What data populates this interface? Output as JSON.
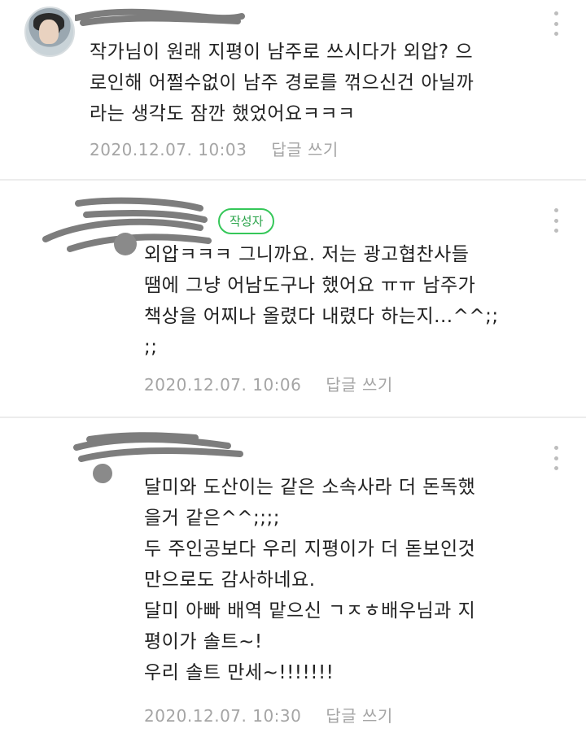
{
  "comments": [
    {
      "is_reply": false,
      "body": "작가님이 원래 지평이 남주로 쓰시다가 외압? 으\n로인해 어쩔수없이 남주 경로를 꺾으신건 아닐까\n라는 생각도 잠깐 했었어요ㅋㅋㅋ",
      "timestamp": "2020.12.07. 10:03",
      "reply_label": "답글 쓰기",
      "more_icon": "more-vertical-icon"
    },
    {
      "is_reply": true,
      "author_badge": "작성자",
      "body": "외압ㅋㅋㅋ 그니까요. 저는 광고협찬사들\n땜에 그냥 어남도구나 했어요 ㅠㅠ 남주가\n책상을 어찌나 올렸다 내렸다 하는지...^^;;\n;;",
      "timestamp": "2020.12.07. 10:06",
      "reply_label": "답글 쓰기",
      "more_icon": "more-vertical-icon"
    },
    {
      "is_reply": true,
      "body": "달미와 도산이는 같은 소속사라 더 돈독했\n을거 같은^^;;;;\n두 주인공보다 우리 지평이가 더 돋보인것\n만으로도 감사하네요.\n달미 아빠 배역 맡으신 ㄱㅈㅎ배우님과 지\n평이가 솔트~!\n우리 솔트 만세~!!!!!!!",
      "timestamp": "2020.12.07. 10:30",
      "reply_label": "답글 쓰기",
      "more_icon": "more-vertical-icon"
    }
  ],
  "colors": {
    "text": "#222222",
    "meta": "#a5a5a5",
    "author_badge": "#35c759",
    "divider": "#ececec",
    "redaction": "#7d7d7d"
  }
}
